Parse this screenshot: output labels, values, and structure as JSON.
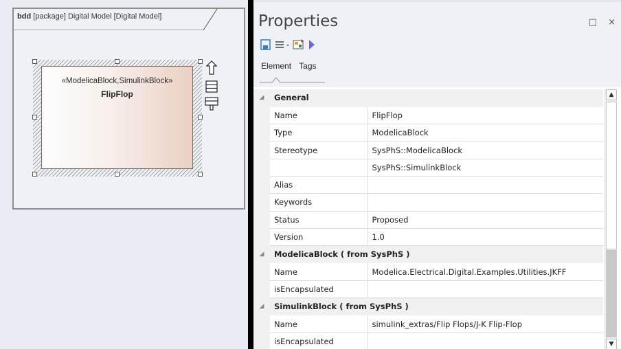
{
  "diagram": {
    "frame_kind": "bdd",
    "frame_title": "[package] Digital Model [Digital Model]",
    "block": {
      "stereotypes": "«ModelicaBlock,SimulinkBlock»",
      "name": "FlipFlop"
    }
  },
  "properties": {
    "title": "Properties",
    "window_controls": {
      "maximize": "□",
      "close": "×"
    },
    "tabs": [
      "Element",
      "Tags"
    ],
    "active_tab": "Element",
    "sections": [
      {
        "title": "General",
        "rows": [
          {
            "key": "Name",
            "value": "FlipFlop"
          },
          {
            "key": "Type",
            "value": "ModelicaBlock"
          },
          {
            "key": "Stereotype",
            "value": "SysPhS::ModelicaBlock"
          },
          {
            "key": "",
            "value": "SysPhS::SimulinkBlock"
          },
          {
            "key": "Alias",
            "value": ""
          },
          {
            "key": "Keywords",
            "value": ""
          },
          {
            "key": "Status",
            "value": "Proposed"
          },
          {
            "key": "Version",
            "value": "1.0"
          }
        ]
      },
      {
        "title": "ModelicaBlock ( from SysPhS )",
        "rows": [
          {
            "key": "Name",
            "value": "Modelica.Electrical.Digital.Examples.Utilities.JKFF"
          },
          {
            "key": "isEncapsulated",
            "value": ""
          }
        ]
      },
      {
        "title": "SimulinkBlock ( from SysPhS )",
        "rows": [
          {
            "key": "Name",
            "value": "simulink_extras/Flip Flops/J-K Flip-Flop"
          },
          {
            "key": "isEncapsulated",
            "value": ""
          }
        ]
      }
    ],
    "toolbar_icons": [
      "save-icon",
      "menu-icon",
      "dropdown-arrow-icon",
      "element-icon",
      "run-arrow-icon"
    ],
    "accent_color": "#6a6ad8"
  }
}
